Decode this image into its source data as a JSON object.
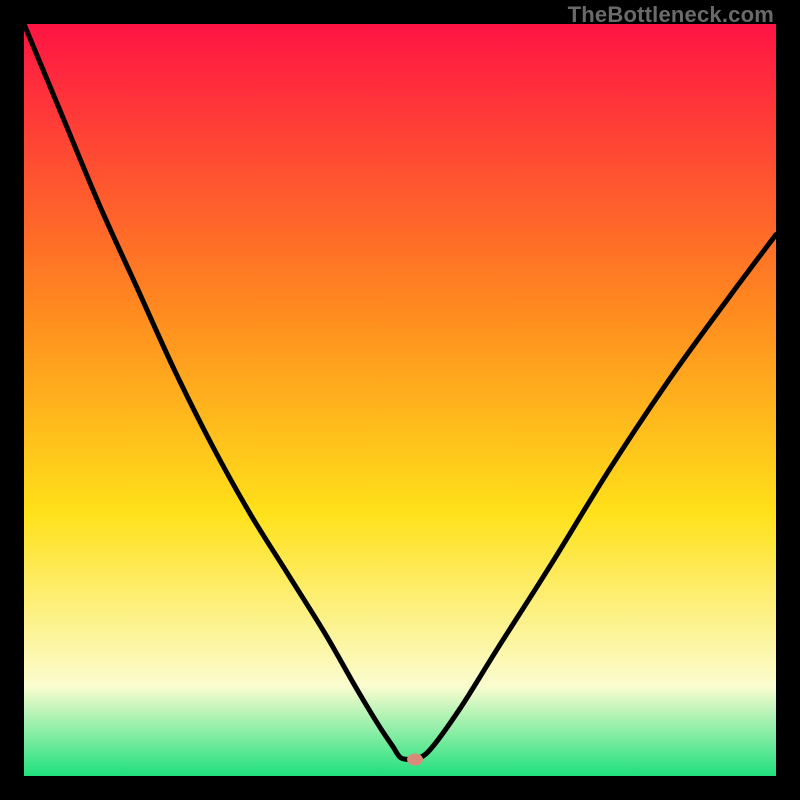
{
  "watermark": "TheBottleneck.com",
  "colors": {
    "gradient_top": "#ff1444",
    "gradient_mid1": "#ff8a1f",
    "gradient_mid2": "#ffe11a",
    "gradient_pale": "#fbfccf",
    "gradient_bottom": "#1fe07e",
    "curve": "#000000",
    "marker": "#d98b7a",
    "frame": "#000000"
  },
  "chart_data": {
    "type": "line",
    "title": "",
    "xlabel": "",
    "ylabel": "",
    "xlim": [
      0,
      100
    ],
    "ylim": [
      0,
      100
    ],
    "marker": {
      "x": 52,
      "y": 2.2
    },
    "series": [
      {
        "name": "bottleneck-curve",
        "x": [
          0,
          5,
          10,
          15,
          20,
          25,
          30,
          35,
          40,
          44,
          47,
          49,
          50,
          51,
          52,
          54,
          58,
          63,
          70,
          78,
          86,
          94,
          100
        ],
        "y": [
          100,
          88,
          76,
          65,
          54,
          44,
          35,
          27,
          19,
          12,
          7,
          4,
          2.5,
          2.2,
          2.2,
          3.5,
          9,
          17,
          28,
          41,
          53,
          64,
          72
        ]
      }
    ]
  }
}
